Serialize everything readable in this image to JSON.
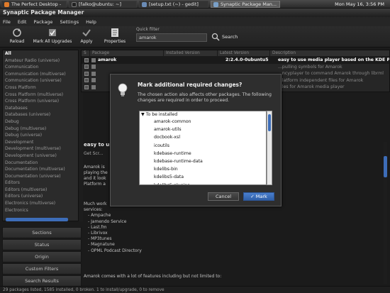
{
  "panel": {
    "tasks": [
      {
        "label": "The Perfect Desktop -",
        "active": false,
        "color": "#e07b2a"
      },
      {
        "label": "[falko@ubuntu: ~]",
        "active": false,
        "color": "#444444"
      },
      {
        "label": "[setup.txt (~) - gedit]",
        "active": false,
        "color": "#6a8bb5"
      },
      {
        "label": "Synaptic Package Man...",
        "active": true,
        "color": "#7aa0c8"
      }
    ],
    "clock": "Mon May 16,  3:56 PM"
  },
  "window": {
    "title": "Synaptic Package Manager"
  },
  "menubar": {
    "items": [
      "File",
      "Edit",
      "Package",
      "Settings",
      "Help"
    ]
  },
  "toolbar": {
    "reload": "Reload",
    "mark_all": "Mark All Upgrades",
    "apply": "Apply",
    "properties": "Properties",
    "quick_filter_label": "Quick filter",
    "quick_filter_value": "amarok",
    "search": "Search"
  },
  "sidebar": {
    "items": [
      "All",
      "Amateur Radio (universe)",
      "Communication",
      "Communication (multiverse)",
      "Communication (universe)",
      "Cross Platform",
      "Cross Platform (multiverse)",
      "Cross Platform (universe)",
      "Databases",
      "Databases (universe)",
      "Debug",
      "Debug (multiverse)",
      "Debug (universe)",
      "Development",
      "Development (multiverse)",
      "Development (universe)",
      "Documentation",
      "Documentation (multiverse)",
      "Documentation (universe)",
      "Editors",
      "Editors (multiverse)",
      "Editors (universe)",
      "Electronics (multiverse)",
      "Electronics"
    ],
    "buttons": [
      "Sections",
      "Status",
      "Origin",
      "Custom Filters",
      "Search Results"
    ]
  },
  "packages": {
    "columns": [
      "S",
      "Package",
      "Installed Version",
      "Latest Version",
      "Description"
    ],
    "rows": [
      {
        "name": "amarok",
        "installed": "",
        "latest": "2:2.4.0-0ubuntu5",
        "desc": "easy to use media player based on the KDE Platform",
        "selected": true
      },
      {
        "name": "",
        "installed": "",
        "latest": "",
        "desc": "...pulling symbols for Amarok",
        "selected": false
      },
      {
        "name": "",
        "installed": "",
        "latest": "",
        "desc": "...ncyplayer to command Amarok through librml",
        "selected": false
      },
      {
        "name": "",
        "installed": "",
        "latest": "",
        "desc": "...latform independent files for Amarok",
        "selected": false
      },
      {
        "name": "",
        "installed": "",
        "latest": "",
        "desc": "...les for Amarok media player",
        "selected": false
      }
    ]
  },
  "details": {
    "title": "easy to use",
    "tab": "Get Scr...",
    "para": [
      "Amarok is",
      "playing the",
      "and it look",
      "Platform a"
    ],
    "list_intro": [
      "Much work",
      "services:"
    ],
    "list": [
      "- Ampache",
      "- Jamendo Service",
      "- Last.fm",
      "- Librivox",
      "- MP3tunes",
      "- Magnatune",
      "- OPML Podcast Directory"
    ],
    "bottom": "Amarok comes with a lot of features including but not limited to:"
  },
  "statusbar": {
    "text": "29 packages listed, 1585 installed, 0 broken. 1 to install/upgrade, 0 to remove"
  },
  "dialog": {
    "title": "Mark additional required changes?",
    "message": "The chosen action also affects other packages. The following changes are required in order to proceed.",
    "group": "To be installed",
    "items": [
      "amarok-common",
      "amarok-utils",
      "docbook-xsl",
      "icoutils",
      "kdebase-runtime",
      "kdebase-runtime-data",
      "kdelibs-bin",
      "kdelibs5-data",
      "kdelibs5-plugins"
    ],
    "cancel": "Cancel",
    "mark": "Mark"
  }
}
